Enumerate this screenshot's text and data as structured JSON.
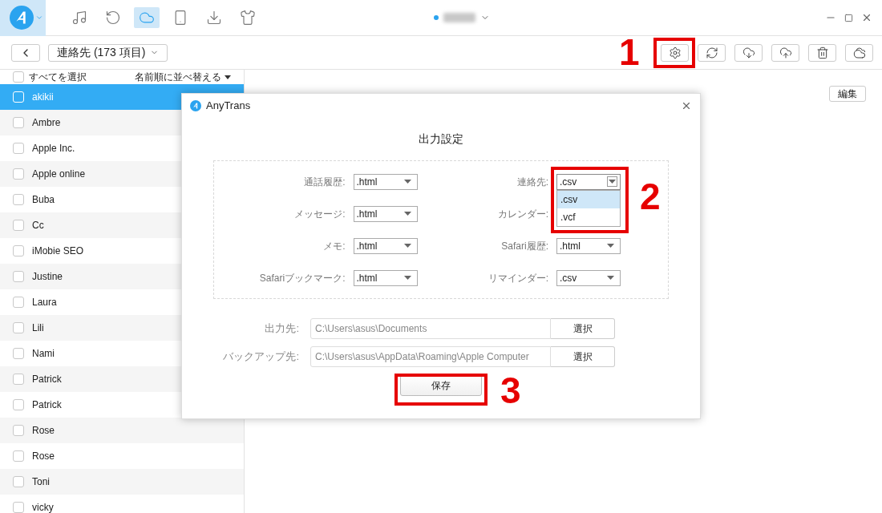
{
  "top_bar": {
    "nav": [
      {
        "kind": "music",
        "selected": false
      },
      {
        "kind": "restore",
        "selected": false
      },
      {
        "kind": "cloud",
        "selected": true
      },
      {
        "kind": "phone",
        "selected": false
      },
      {
        "kind": "download",
        "selected": false
      },
      {
        "kind": "shirt",
        "selected": false
      }
    ]
  },
  "toolbar": {
    "category": "連絡先 (173 項目)",
    "actions": [
      {
        "kind": "settings"
      },
      {
        "kind": "sync"
      },
      {
        "kind": "cloud-download"
      },
      {
        "kind": "cloud-upload"
      },
      {
        "kind": "trash"
      },
      {
        "kind": "clouds"
      }
    ]
  },
  "list": {
    "select_all": {
      "label": "すべてを選択",
      "checked": false
    },
    "sort": "名前順に並べ替える",
    "rows": [
      {
        "name": "akikii",
        "selected": true,
        "checked": false
      },
      {
        "name": "Ambre",
        "selected": false,
        "checked": false
      },
      {
        "name": "Apple Inc.",
        "selected": false,
        "checked": false
      },
      {
        "name": "Apple online",
        "selected": false,
        "checked": false
      },
      {
        "name": "Buba",
        "selected": false,
        "checked": false
      },
      {
        "name": "Cc",
        "selected": false,
        "checked": false
      },
      {
        "name": "iMobie SEO",
        "selected": false,
        "checked": false
      },
      {
        "name": "Justine",
        "selected": false,
        "checked": false
      },
      {
        "name": "Laura",
        "selected": false,
        "checked": false
      },
      {
        "name": "Lili",
        "selected": false,
        "checked": false
      },
      {
        "name": "Nami",
        "selected": false,
        "checked": false
      },
      {
        "name": "Patrick",
        "selected": false,
        "checked": false
      },
      {
        "name": "Patrick",
        "selected": false,
        "checked": false
      },
      {
        "name": "Rose",
        "selected": false,
        "checked": false
      },
      {
        "name": "Rose",
        "selected": false,
        "checked": false
      },
      {
        "name": "Toni",
        "selected": false,
        "checked": false
      },
      {
        "name": "vicky",
        "selected": false,
        "checked": false
      }
    ]
  },
  "edit_button": "編集",
  "dialog": {
    "title": "AnyTrans",
    "heading": "出力設定",
    "formats": [
      {
        "label": "通話履歴:",
        "value": ".html",
        "open": false
      },
      {
        "label": "連絡先:",
        "value": ".csv",
        "open": true
      },
      {
        "label": "メッセージ:",
        "value": ".html",
        "open": false
      },
      {
        "label": "カレンダー:",
        "open": false
      },
      {
        "label": "メモ:",
        "value": ".html",
        "open": false
      },
      {
        "label": "Safari履歴:",
        "value": ".html",
        "open": false
      },
      {
        "label": "Safariブックマーク:",
        "value": ".html",
        "open": false
      },
      {
        "label": "リマインダー:",
        "value": ".csv",
        "open": false
      }
    ],
    "dropdown": [
      {
        "label": ".csv",
        "selected": true
      },
      {
        "label": ".vcf",
        "selected": false
      }
    ],
    "paths": [
      {
        "label": "出力先:",
        "value": "C:\\Users\\asus\\Documents",
        "button": "選択"
      },
      {
        "label": "バックアップ先:",
        "value": "C:\\Users\\asus\\AppData\\Roaming\\Apple Computer",
        "button": "選択"
      }
    ],
    "save": "保存"
  },
  "annotations": [
    {
      "label": "1"
    },
    {
      "label": "2"
    },
    {
      "label": "3"
    }
  ]
}
